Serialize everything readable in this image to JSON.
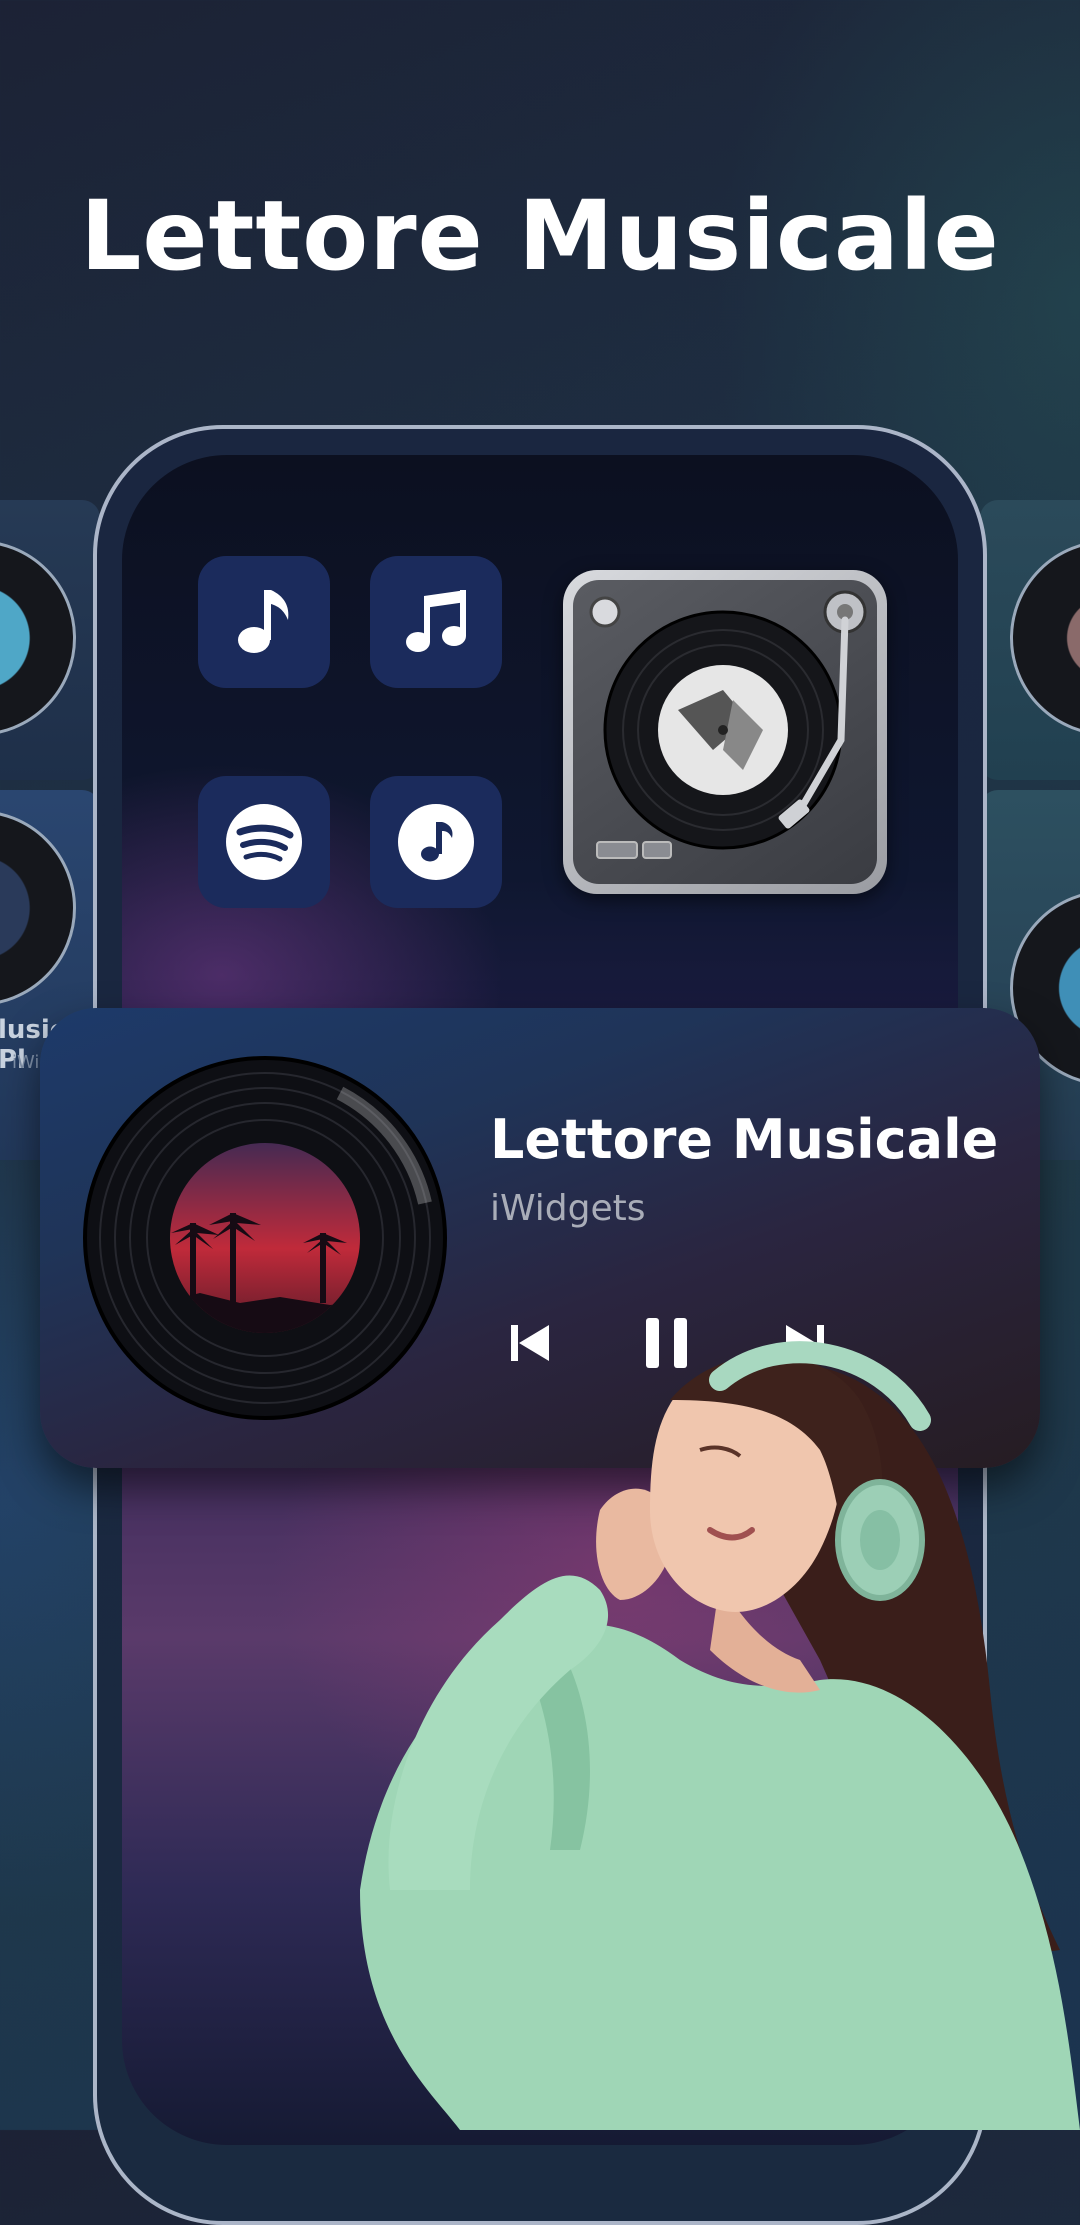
{
  "headline": "Lettore Musicale",
  "side_cards": {
    "left_label": "lusic Pl",
    "left_sub": "iWid"
  },
  "apps": [
    {
      "name": "music-note-app",
      "icon": "eighth-note-icon"
    },
    {
      "name": "music-notes-app",
      "icon": "beamed-notes-icon"
    },
    {
      "name": "spotify-app",
      "icon": "spotify-icon"
    },
    {
      "name": "music-circle-app",
      "icon": "note-circle-icon"
    }
  ],
  "player": {
    "title": "Lettore Musicale",
    "artist": "iWidgets",
    "controls": [
      "previous-icon",
      "pause-icon",
      "next-icon"
    ]
  },
  "colors": {
    "app_tile": "#1b2b5c",
    "text_primary": "#ffffff",
    "text_secondary": "#a9adb8",
    "hoodie": "#9fd6b6"
  }
}
